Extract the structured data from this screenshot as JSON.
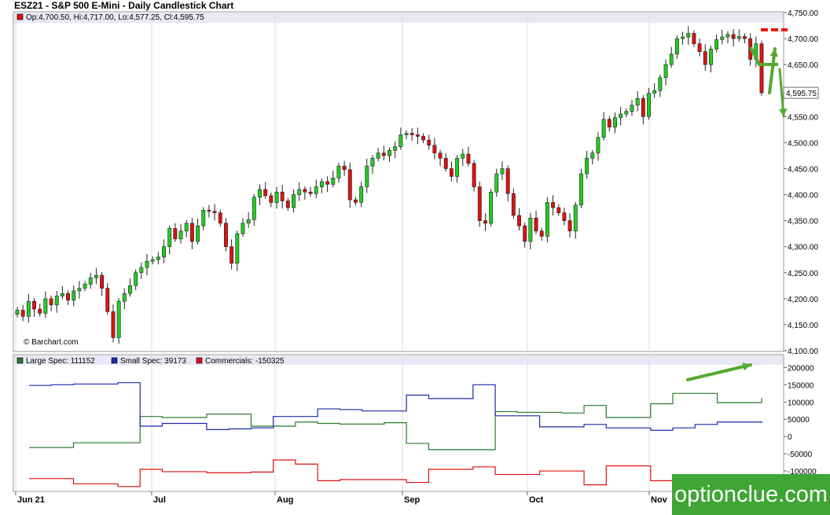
{
  "title": "ESZ21 - S&P 500 E-Mini - Daily Candlestick Chart",
  "watermark": "optionclue.com",
  "credit": "© Barchart.com",
  "colors": {
    "up": "#22cc22",
    "down": "#dd1111",
    "large": "#2a7a2a",
    "small": "#1a2aaa",
    "comm": "#dd1111",
    "arrow": "#55a832",
    "dash": "#ee1111"
  },
  "chart_data": [
    {
      "type": "candlestick",
      "ohlc_legend": "Op:4,700.50, Hi:4,717.00, Lo:4,577.25, Cl:4,595.75",
      "last_price_label": "4,595.75",
      "ylim": [
        4100,
        4750
      ],
      "y_ticks": [
        "4,750.00",
        "4,700.00",
        "4,650.00",
        "4,600.00",
        "4,550.00",
        "4,500.00",
        "4,450.00",
        "4,400.00",
        "4,350.00",
        "4,300.00",
        "4,250.00",
        "4,200.00",
        "4,150.00",
        "4,100.00"
      ],
      "x_ticks": [
        "Jun 21",
        "Jul",
        "Aug",
        "Sep",
        "Oct",
        "Nov"
      ],
      "close": [
        4178,
        4166,
        4195,
        4180,
        4172,
        4200,
        4188,
        4205,
        4210,
        4197,
        4215,
        4220,
        4228,
        4240,
        4245,
        4220,
        4175,
        4125,
        4195,
        4210,
        4225,
        4250,
        4260,
        4272,
        4275,
        4280,
        4300,
        4335,
        4315,
        4330,
        4345,
        4310,
        4340,
        4370,
        4368,
        4365,
        4345,
        4300,
        4268,
        4325,
        4345,
        4352,
        4395,
        4410,
        4398,
        4385,
        4405,
        4388,
        4375,
        4400,
        4410,
        4405,
        4402,
        4415,
        4425,
        4420,
        4432,
        4455,
        4448,
        4390,
        4385,
        4415,
        4455,
        4470,
        4480,
        4475,
        4485,
        4492,
        4515,
        4518,
        4515,
        4512,
        4505,
        4495,
        4480,
        4470,
        4450,
        4435,
        4470,
        4478,
        4460,
        4415,
        4350,
        4345,
        4405,
        4440,
        4450,
        4402,
        4360,
        4340,
        4310,
        4355,
        4330,
        4320,
        4385,
        4375,
        4365,
        4350,
        4330,
        4380,
        4440,
        4470,
        4480,
        4510,
        4545,
        4530,
        4548,
        4555,
        4560,
        4572,
        4585,
        4550,
        4595,
        4600,
        4625,
        4650,
        4670,
        4700,
        4703,
        4710,
        4690,
        4675,
        4650,
        4680,
        4698,
        4703,
        4708,
        4700,
        4704,
        4700,
        4660,
        4690,
        4595.75
      ]
    },
    {
      "type": "line",
      "ylim": [
        -150000,
        210000
      ],
      "y_ticks": [
        "200000",
        "150000",
        "100000",
        "50000",
        "0",
        "-50000",
        "-100000"
      ],
      "series": [
        {
          "name": "Large Spec",
          "legend": "Large Spec: 111152",
          "values": [
            -32000,
            -32000,
            -18000,
            -18000,
            -18000,
            58000,
            55000,
            55000,
            65000,
            65000,
            30000,
            30000,
            42000,
            38000,
            36000,
            36000,
            40000,
            -20000,
            -38000,
            -38000,
            -38000,
            72000,
            70000,
            70000,
            68000,
            90000,
            55000,
            55000,
            95000,
            125000,
            125000,
            98000,
            98000,
            111152
          ]
        },
        {
          "name": "Small Spec",
          "legend": "Small Spec: 39173",
          "values": [
            148000,
            150000,
            152000,
            152000,
            156000,
            30000,
            38000,
            38000,
            20000,
            22000,
            25000,
            58000,
            58000,
            80000,
            78000,
            74000,
            74000,
            120000,
            110000,
            110000,
            150000,
            60000,
            60000,
            28000,
            28000,
            35000,
            25000,
            25000,
            18000,
            25000,
            35000,
            42000,
            42000,
            39173
          ]
        },
        {
          "name": "Commercials",
          "legend": "Commercials: -150325",
          "values": [
            -122000,
            -122000,
            -137000,
            -137000,
            -145000,
            -95000,
            -102000,
            -102000,
            -105000,
            -105000,
            -103000,
            -68000,
            -80000,
            -128000,
            -125000,
            -125000,
            -125000,
            -133000,
            -95000,
            -95000,
            -88000,
            -110000,
            -110000,
            -100000,
            -100000,
            -140000,
            -85000,
            -85000,
            -128000,
            -150000,
            -140000,
            -140000,
            -150325,
            -150325
          ]
        }
      ]
    }
  ]
}
